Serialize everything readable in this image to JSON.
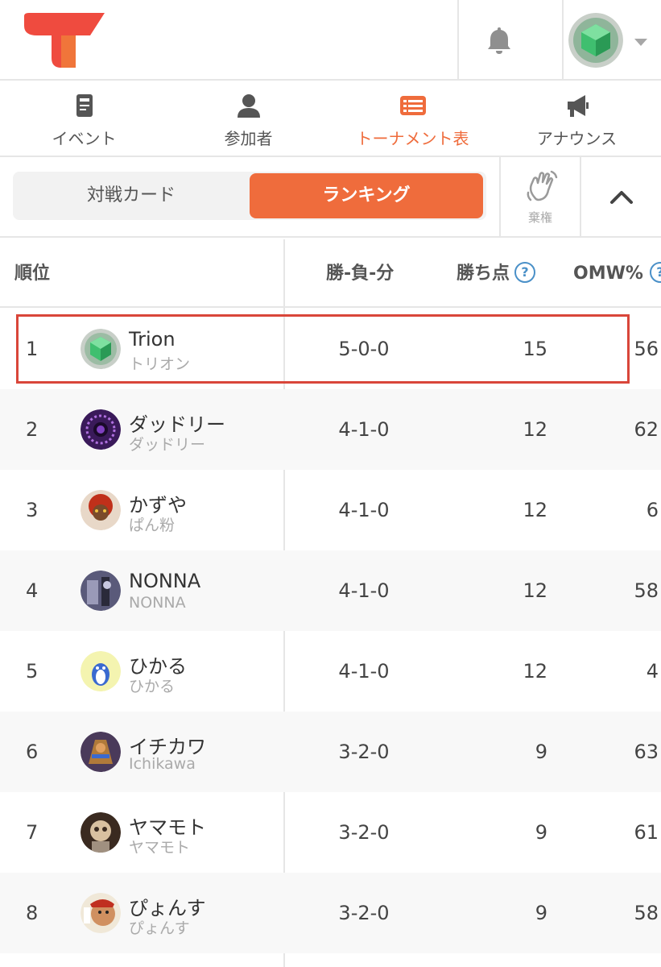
{
  "header": {
    "logo_icon": "brand-logo",
    "bell_icon": "bell-icon",
    "avatar_icon": "user-avatar",
    "dropdown_icon": "caret-down-icon"
  },
  "nav": {
    "tabs": [
      {
        "label": "イベント",
        "icon": "document-icon",
        "active": false
      },
      {
        "label": "参加者",
        "icon": "person-icon",
        "active": false
      },
      {
        "label": "トーナメント表",
        "icon": "bracket-icon",
        "active": true
      },
      {
        "label": "アナウンス",
        "icon": "megaphone-icon",
        "active": false
      }
    ]
  },
  "segment": {
    "matchups": "対戦カード",
    "ranking": "ランキング"
  },
  "drop": {
    "label": "棄権",
    "icon": "hand-wave-icon"
  },
  "collapse_icon": "chevron-up-icon",
  "table": {
    "headers": {
      "rank": "順位",
      "record": "勝-負-分",
      "points": "勝ち点",
      "omw": "OMW%"
    },
    "rows": [
      {
        "rank": "1",
        "name": "Trion",
        "sub": "トリオン",
        "record": "5-0-0",
        "points": "15",
        "omw": "56"
      },
      {
        "rank": "2",
        "name": "ダッドリー",
        "sub": "ダッドリー",
        "record": "4-1-0",
        "points": "12",
        "omw": "62"
      },
      {
        "rank": "3",
        "name": "かずや",
        "sub": "ぱん粉",
        "record": "4-1-0",
        "points": "12",
        "omw": "6"
      },
      {
        "rank": "4",
        "name": "NONNA",
        "sub": "NONNA",
        "record": "4-1-0",
        "points": "12",
        "omw": "58"
      },
      {
        "rank": "5",
        "name": "ひかる",
        "sub": "ひかる",
        "record": "4-1-0",
        "points": "12",
        "omw": "4"
      },
      {
        "rank": "6",
        "name": "イチカワ",
        "sub": "Ichikawa",
        "record": "3-2-0",
        "points": "9",
        "omw": "63"
      },
      {
        "rank": "7",
        "name": "ヤマモト",
        "sub": "ヤマモト",
        "record": "3-2-0",
        "points": "9",
        "omw": "61"
      },
      {
        "rank": "8",
        "name": "ぴょんす",
        "sub": "ぴょんす",
        "record": "3-2-0",
        "points": "9",
        "omw": "58"
      }
    ]
  },
  "colors": {
    "accent": "#ef6c3c",
    "highlight": "#d9463a",
    "help": "#4a90c8"
  }
}
